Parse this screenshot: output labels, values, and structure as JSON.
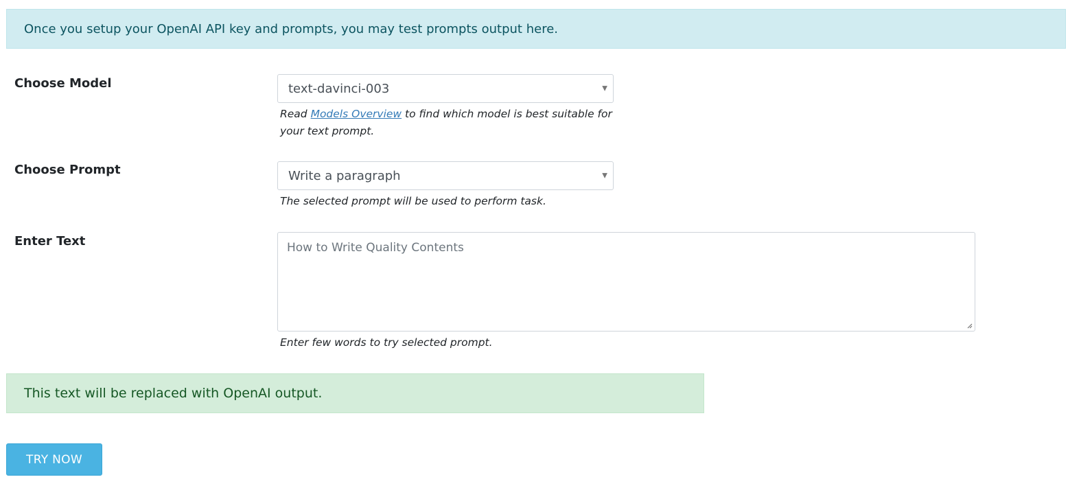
{
  "banner": {
    "text": "Once you setup your OpenAI API key and prompts, you may test prompts output here."
  },
  "model": {
    "label": "Choose Model",
    "selected": "text-davinci-003",
    "help_before": "Read ",
    "help_link": "Models Overview",
    "help_after": " to find which model is best suitable for your text prompt."
  },
  "prompt": {
    "label": "Choose Prompt",
    "selected": "Write a paragraph",
    "help": "The selected prompt will be used to perform task."
  },
  "text": {
    "label": "Enter Text",
    "placeholder": "How to Write Quality Contents",
    "help": "Enter few words to try selected prompt."
  },
  "output": {
    "text": "This text will be replaced with OpenAI output."
  },
  "actions": {
    "try_label": "TRY NOW"
  },
  "colors": {
    "info_bg": "#d1ecf1",
    "success_bg": "#d4edda",
    "button_bg": "#4ab3e2",
    "link": "#337ab7"
  }
}
